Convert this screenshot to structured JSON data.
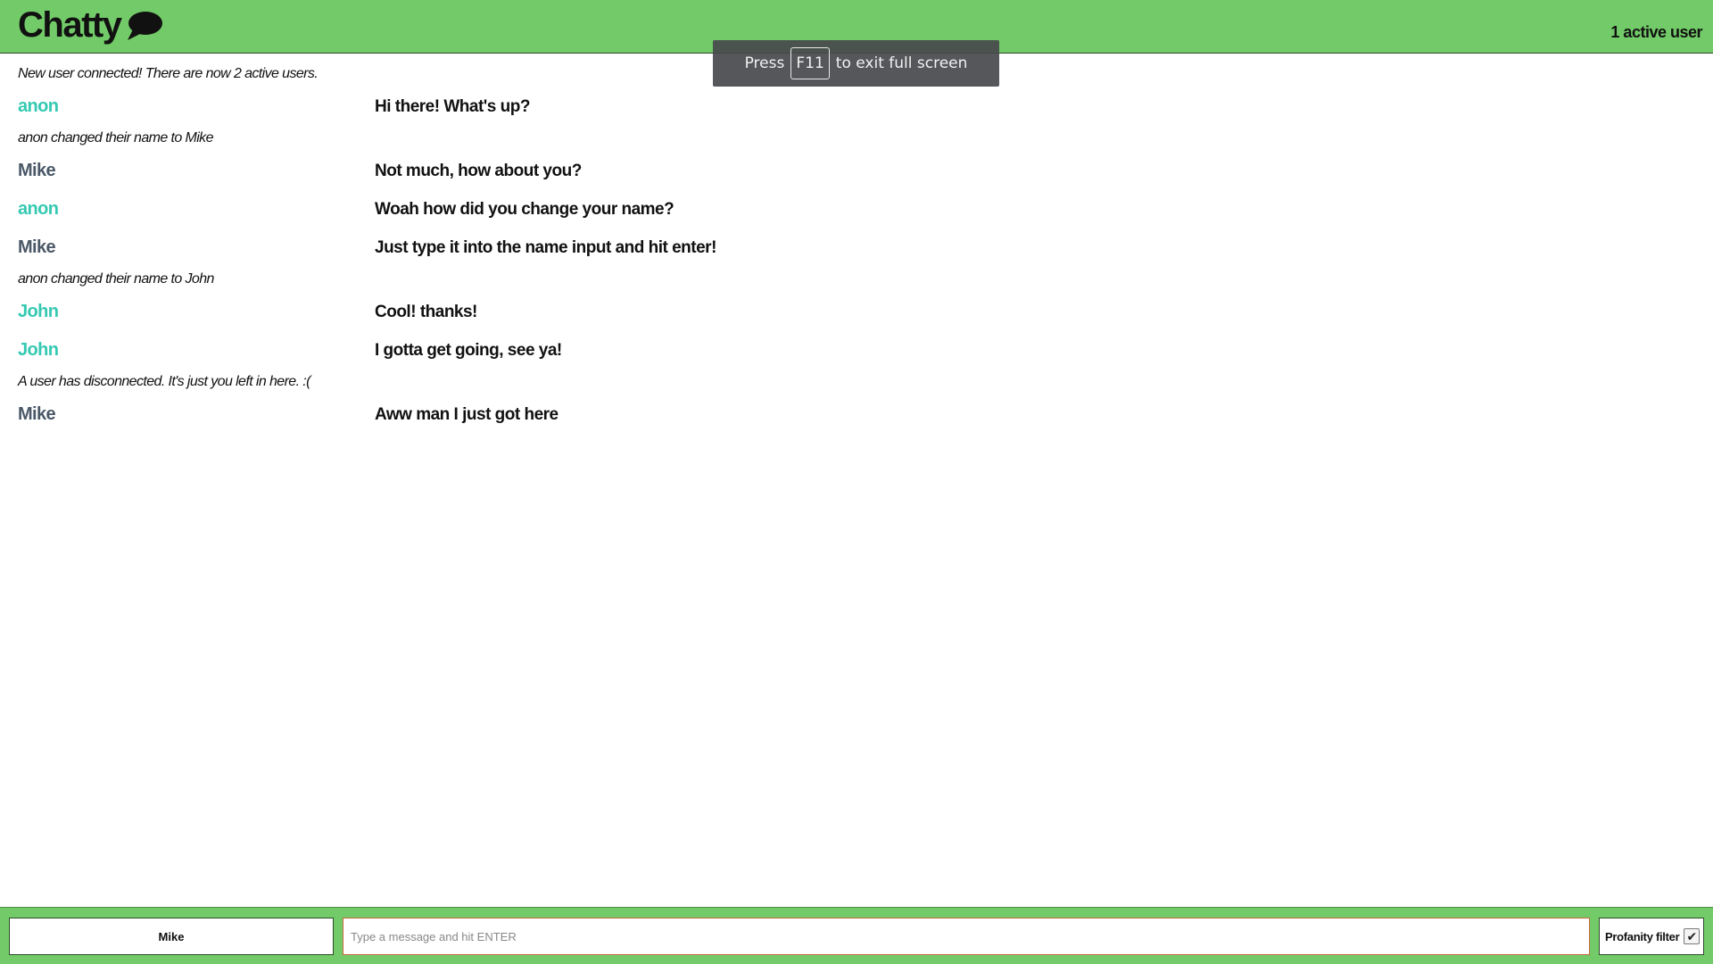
{
  "header": {
    "title": "Chatty",
    "active_users": "1 active user",
    "background_color": "#72cb68"
  },
  "fullscreen_toast": {
    "prefix": "Press",
    "key": "F11",
    "suffix": "to exit full screen"
  },
  "messages": [
    {
      "type": "system",
      "text": "New user connected! There are now 2 active users."
    },
    {
      "type": "chat",
      "user": "anon",
      "user_color": "#35c9b2",
      "text": "Hi there! What's up?"
    },
    {
      "type": "system",
      "text": "anon changed their name to Mike"
    },
    {
      "type": "chat",
      "user": "Mike",
      "user_color": "#4a5868",
      "text": "Not much, how about you?"
    },
    {
      "type": "chat",
      "user": "anon",
      "user_color": "#35c9b2",
      "text": "Woah how did you change your name?"
    },
    {
      "type": "chat",
      "user": "Mike",
      "user_color": "#4a5868",
      "text": "Just type it into the name input and hit enter!"
    },
    {
      "type": "system",
      "text": "anon changed their name to John"
    },
    {
      "type": "chat",
      "user": "John",
      "user_color": "#35c9b2",
      "text": "Cool! thanks!"
    },
    {
      "type": "chat",
      "user": "John",
      "user_color": "#35c9b2",
      "text": "I gotta get going, see ya!"
    },
    {
      "type": "system",
      "text": "A user has disconnected. It's just you left in here. :("
    },
    {
      "type": "chat",
      "user": "Mike",
      "user_color": "#4a5868",
      "text": "Aww man I just got here"
    }
  ],
  "footer": {
    "name_value": "Mike",
    "message_placeholder": "Type a message and hit ENTER",
    "message_value": "",
    "profanity_filter_label": "Profanity filter",
    "profanity_filter_checked": true
  }
}
